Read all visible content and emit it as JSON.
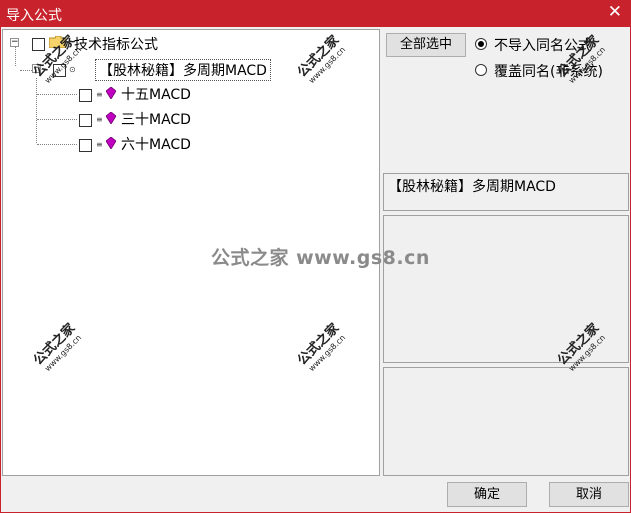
{
  "window": {
    "title": "导入公式",
    "close_glyph": "✕"
  },
  "tree": {
    "root": {
      "label": "技术指标公式",
      "expander": "−"
    },
    "group": {
      "label": "【股林秘籍】多周期MACD",
      "expander": "−"
    },
    "items": [
      {
        "label": "十五MACD"
      },
      {
        "label": "三十MACD"
      },
      {
        "label": "六十MACD"
      }
    ]
  },
  "options": {
    "select_all_label": "全部选中",
    "radios": [
      {
        "label": "不导入同名公式",
        "selected": true
      },
      {
        "label": "覆盖同名(非系统)",
        "selected": false
      }
    ]
  },
  "info": {
    "selected_name": "【股林秘籍】多周期MACD"
  },
  "footer": {
    "ok_label": "确定",
    "cancel_label": "取消"
  },
  "watermark": {
    "text": "公式之家 www.gs8.cn",
    "stamp_cn": "公式之家",
    "stamp_url": "www.gs8.cn"
  },
  "colors": {
    "titlebar": "#c8232c",
    "background": "#f0f0f0",
    "gem": "#c000c0"
  }
}
